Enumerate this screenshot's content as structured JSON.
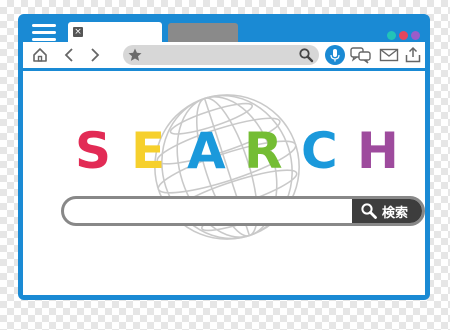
{
  "browser": {
    "tab_close_label": "×",
    "colors": {
      "frame": "#1a8ad4",
      "tab_active": "#ffffff",
      "tab_inactive": "#8a8a8a",
      "dot_teal": "#22c4b8",
      "dot_red": "#e4465d",
      "dot_purple": "#9b5cc9",
      "address_bar": "#d7d7d7",
      "mic": "#1a8ad4"
    },
    "icons": {
      "menu": "hamburger-icon",
      "home": "home-icon",
      "back": "chevron-left-icon",
      "forward": "chevron-right-icon",
      "bookmark": "star-icon",
      "search": "magnifier-icon",
      "voice": "microphone-icon",
      "chat": "chat-bubbles-icon",
      "mail": "mail-icon",
      "share": "share-icon"
    }
  },
  "main": {
    "title_letters": [
      {
        "char": "S",
        "color": "#e22b55"
      },
      {
        "char": "E",
        "color": "#f6d02d"
      },
      {
        "char": "A",
        "color": "#1b99db"
      },
      {
        "char": "R",
        "color": "#74bd34"
      },
      {
        "char": "C",
        "color": "#1b99db"
      },
      {
        "char": "H",
        "color": "#9e4b9d"
      }
    ],
    "search": {
      "value": "",
      "button_label": "検索",
      "button_icon": "magnifier-icon",
      "button_color": "#3d3d3d"
    },
    "background_icon": "globe-icon"
  }
}
